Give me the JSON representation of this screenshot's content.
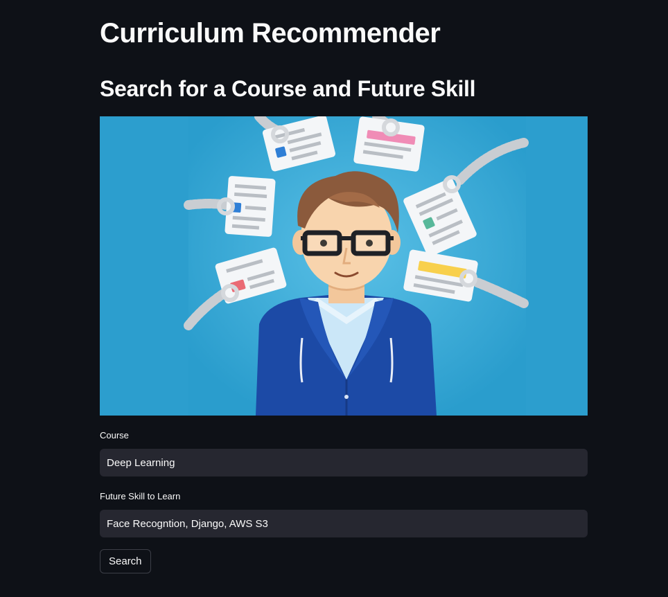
{
  "header": {
    "title": "Curriculum Recommender",
    "subtitle": "Search for a Course and Future Skill"
  },
  "form": {
    "course": {
      "label": "Course",
      "value": "Deep Learning"
    },
    "future_skill": {
      "label": "Future Skill to Learn",
      "value": "Face Recogntion, Django, AWS S3"
    },
    "search_label": "Search"
  },
  "colors": {
    "background": "#0e1117",
    "input_background": "#262730",
    "hero_background": "#2c9ece"
  }
}
